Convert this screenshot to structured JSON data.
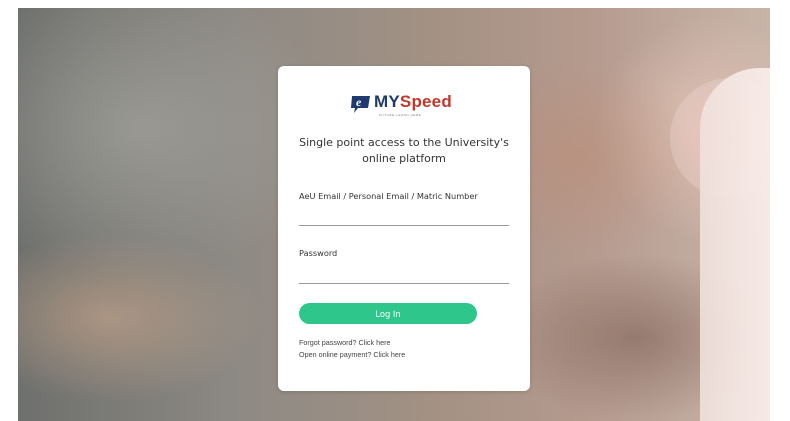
{
  "logo": {
    "prefix": "MY",
    "brand": "Speed",
    "tagline": "FUTURE LEARN HERE",
    "icon": "e-speech-bubble-icon"
  },
  "login": {
    "heading": "Single point access to the University's online platform",
    "email_label": "AeU Email / Personal Email / Matric Number",
    "email_value": "",
    "password_label": "Password",
    "password_value": "",
    "submit_label": "Log In"
  },
  "links": {
    "forgot_text": "Forgot password?",
    "forgot_link": "Click here",
    "payment_text": "Open online payment?",
    "payment_link": "Click here"
  },
  "colors": {
    "accent": "#2ec68a",
    "brand_blue": "#1e3a6e",
    "brand_red": "#c0392b"
  }
}
